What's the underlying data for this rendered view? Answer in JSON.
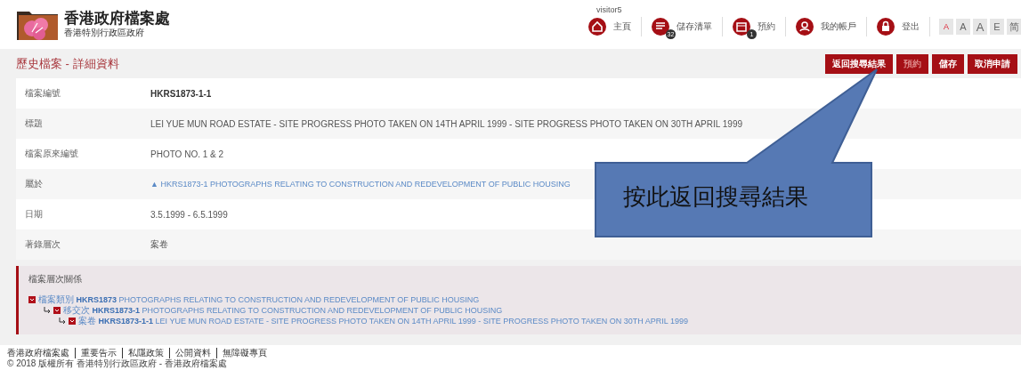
{
  "header": {
    "title": "香港政府檔案處",
    "subtitle": "香港特別行政區政府",
    "user": "visitor5",
    "nav": [
      {
        "label": "主頁"
      },
      {
        "label": "儲存清單",
        "badge": "32"
      },
      {
        "label": "預約",
        "badge": "1"
      },
      {
        "label": "我的帳戶"
      },
      {
        "label": "登出"
      }
    ],
    "font_buttons": [
      {
        "label": "A",
        "selected": true
      },
      {
        "label": "A",
        "selected": false
      },
      {
        "label": "A",
        "selected": false
      },
      {
        "label": "E",
        "selected": false
      },
      {
        "label": "简",
        "selected": false
      }
    ]
  },
  "page_title": "歷史檔案 - 詳細資料",
  "actions": [
    {
      "label": "返回搜尋結果",
      "disabled": false
    },
    {
      "label": "預約",
      "disabled": true
    },
    {
      "label": "儲存",
      "disabled": false
    },
    {
      "label": "取消申請",
      "disabled": false
    }
  ],
  "fields": [
    {
      "label": "檔案編號",
      "value": "HKRS1873-1-1",
      "kind": "bold"
    },
    {
      "label": "標題",
      "value": "LEI YUE MUN ROAD ESTATE - SITE PROGRESS PHOTO TAKEN ON 14TH APRIL 1999 - SITE PROGRESS PHOTO TAKEN ON 30TH APRIL 1999",
      "kind": "text"
    },
    {
      "label": "檔案原來編號",
      "value": "PHOTO NO. 1 & 2",
      "kind": "text"
    },
    {
      "label": "屬於",
      "value": "▲ HKRS1873-1 PHOTOGRAPHS RELATING TO CONSTRUCTION AND REDEVELOPMENT OF PUBLIC HOUSING",
      "kind": "link"
    },
    {
      "label": "日期",
      "value": "3.5.1999 - 6.5.1999",
      "kind": "text"
    },
    {
      "label": "著錄層次",
      "value": "案卷",
      "kind": "text"
    }
  ],
  "hierarchy": {
    "title": "檔案層次關係",
    "items": [
      {
        "level": "檔案類別",
        "code": "HKRS1873",
        "title": "PHOTOGRAPHS RELATING TO CONSTRUCTION AND REDEVELOPMENT OF PUBLIC HOUSING",
        "children": [
          {
            "level": "移交次",
            "code": "HKRS1873-1",
            "title": "PHOTOGRAPHS RELATING TO CONSTRUCTION AND REDEVELOPMENT OF PUBLIC HOUSING",
            "children": [
              {
                "level": "案卷",
                "code": "HKRS1873-1-1",
                "title": "LEI YUE MUN ROAD ESTATE - SITE PROGRESS PHOTO TAKEN ON 14TH APRIL 1999 - SITE PROGRESS PHOTO TAKEN ON 30TH APRIL 1999"
              }
            ]
          }
        ]
      }
    ]
  },
  "callout": {
    "text": "按此返回搜尋結果"
  },
  "footer": {
    "links": [
      "香港政府檔案處",
      "重要告示",
      "私隱政策",
      "公開資料",
      "無障礙專頁"
    ],
    "copyright": "© 2018 版權所有 香港特別行政區政府 - 香港政府檔案處"
  }
}
